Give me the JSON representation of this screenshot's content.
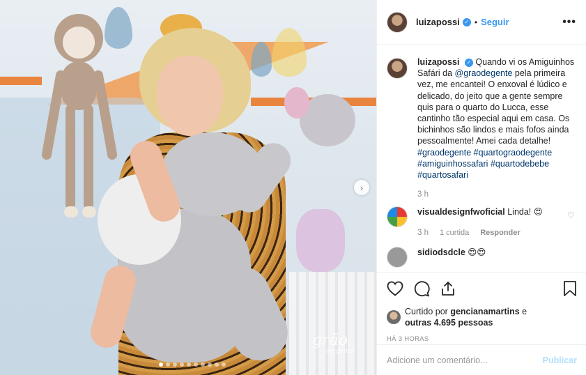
{
  "header": {
    "username": "luizapossi",
    "separator": "•",
    "follow_label": "Seguir",
    "more_label": "•••"
  },
  "photo": {
    "watermark_line1": "grão",
    "watermark_line2": "de gente",
    "carousel_count": 10,
    "carousel_active": 0
  },
  "caption": {
    "username": "luizapossi",
    "text_1": "Quando vi os Amiguinhos Safári da",
    "mention": "@graodegente",
    "text_2": "pela primeira vez, me encantei! O enxoval é lúdico e delicado, do jeito que a gente sempre quis para o quarto do Lucca, esse cantinho tão especial aqui em casa. Os bichinhos são lindos e mais fofos ainda pessoalmente! Amei cada detalhe!",
    "hashtags": [
      "#graodegente",
      "#quartograodegente",
      "#amiguinhossafari",
      "#quartodebebe",
      "#quartosafari"
    ],
    "time": "3 h"
  },
  "comments": [
    {
      "username": "visualdesignfwoficial",
      "text": "Linda! 😍",
      "time": "3 h",
      "likes": "1 curtida",
      "reply_label": "Responder"
    }
  ],
  "partial_comment": {
    "username": "sidiodsdcle",
    "text": "😍😍"
  },
  "likes": {
    "prefix": "Curtido por",
    "user": "gencianamartins",
    "connector": "e",
    "others": "outras 4.695 pessoas"
  },
  "posted_ago": "HÁ 3 HORAS",
  "add_comment": {
    "placeholder": "Adicione um comentário...",
    "publish_label": "Publicar"
  },
  "colors": {
    "accent": "#3897f0",
    "link": "#00376b",
    "muted": "#8e8e8e",
    "publish_disabled": "#b2dffc"
  }
}
